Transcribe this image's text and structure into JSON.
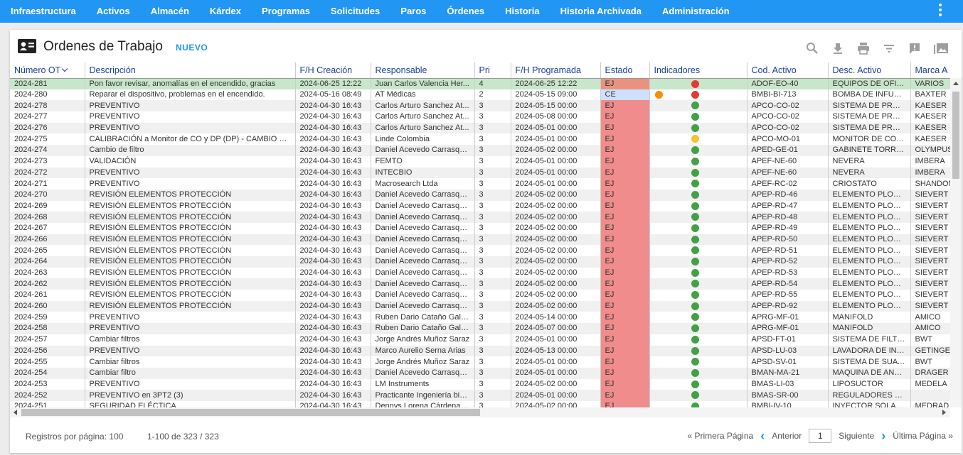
{
  "nav": {
    "items": [
      "Infraestructura",
      "Activos",
      "Almacén",
      "Kárdex",
      "Programas",
      "Solicitudes",
      "Paros",
      "Órdenes",
      "Historia",
      "Historia Archivada",
      "Administración"
    ],
    "more_icon": "more-vert-icon"
  },
  "header": {
    "title": "Ordenes de Trabajo",
    "new_label": "NUEVO",
    "tools": [
      "search-icon",
      "download-icon",
      "print-icon",
      "filter-icon",
      "comment-icon",
      "gallery-icon"
    ]
  },
  "table": {
    "columns": [
      "Número OT",
      "Descripción",
      "F/H Creación",
      "Responsable",
      "Pri",
      "F/H Programada",
      "Estado",
      "Indicadores",
      "Cod. Activo",
      "Desc. Activo",
      "Marca A"
    ],
    "rows": [
      {
        "ot": "2024-281",
        "desc": "Pon favor revisar, anomalías en el encendido, gracias",
        "created": "2024-06-25 12:22",
        "resp": "Juan Carlos Valencia Her...",
        "pri": "4",
        "sched": "2024-06-25 12:22",
        "estado": "EJ",
        "ind": "red",
        "extra": "",
        "cod": "ADOF-EO-40",
        "dact": "EQUIPOS DE OFICI...",
        "marca": "VARIOS"
      },
      {
        "ot": "2024-280",
        "desc": "Reparar el dispositivo, problemas en el encendido.",
        "created": "2024-05-16 08:49",
        "resp": "AT Médicas",
        "pri": "2",
        "sched": "2024-05-15 09:00",
        "estado": "CE",
        "ind": "red",
        "extra": "orange",
        "cod": "BMBI-BI-713",
        "dact": "BOMBA DE INFUSI...",
        "marca": "BAXTER"
      },
      {
        "ot": "2024-278",
        "desc": "PREVENTIVO",
        "created": "2024-04-30 16:43",
        "resp": "Carlos Arturo Sanchez At...",
        "pri": "3",
        "sched": "2024-05-15 00:00",
        "estado": "EJ",
        "ind": "green",
        "extra": "",
        "cod": "APCO-CO-02",
        "dact": "SISTEMA DE PROD...",
        "marca": "KAESER"
      },
      {
        "ot": "2024-277",
        "desc": "PREVENTIVO",
        "created": "2024-04-30 16:43",
        "resp": "Carlos Arturo Sanchez At...",
        "pri": "3",
        "sched": "2024-05-08 00:00",
        "estado": "EJ",
        "ind": "green",
        "extra": "",
        "cod": "APCO-CO-02",
        "dact": "SISTEMA DE PROD...",
        "marca": "KAESER"
      },
      {
        "ot": "2024-276",
        "desc": "PREVENTIVO",
        "created": "2024-04-30 16:43",
        "resp": "Carlos Arturo Sanchez At...",
        "pri": "3",
        "sched": "2024-05-01 00:00",
        "estado": "EJ",
        "ind": "green",
        "extra": "",
        "cod": "APCO-CO-02",
        "dact": "SISTEMA DE PROD...",
        "marca": "KAESER"
      },
      {
        "ot": "2024-275",
        "desc": "CALIBRACIÓN a Monitor de CO y DP (DP) - CAMBIO DE ...",
        "created": "2024-04-30 16:43",
        "resp": "Linde Colombia",
        "pri": "3",
        "sched": "2024-05-01 00:00",
        "estado": "EJ",
        "ind": "yellow",
        "extra": "",
        "cod": "APCO-MO-01",
        "dact": "MONITOR DE CO Y ...",
        "marca": "KAESER"
      },
      {
        "ot": "2024-274",
        "desc": "Cambio de filtro",
        "created": "2024-04-30 16:43",
        "resp": "Daniel Acevedo Carrasqu...",
        "pri": "3",
        "sched": "2024-05-02 00:00",
        "estado": "EJ",
        "ind": "green",
        "extra": "",
        "cod": "APED-GE-01",
        "dact": "GABINETE TORRE ...",
        "marca": "OLYMPUS"
      },
      {
        "ot": "2024-273",
        "desc": "VALIDACIÓN",
        "created": "2024-04-30 16:43",
        "resp": "FEMTO",
        "pri": "3",
        "sched": "2024-05-01 00:00",
        "estado": "EJ",
        "ind": "green",
        "extra": "",
        "cod": "APEF-NE-60",
        "dact": "NEVERA",
        "marca": "IMBERA"
      },
      {
        "ot": "2024-272",
        "desc": "PREVENTIVO",
        "created": "2024-04-30 16:43",
        "resp": "INTECBIO",
        "pri": "3",
        "sched": "2024-05-01 00:00",
        "estado": "EJ",
        "ind": "green",
        "extra": "",
        "cod": "APEF-NE-60",
        "dact": "NEVERA",
        "marca": "IMBERA"
      },
      {
        "ot": "2024-271",
        "desc": "PREVENTIVO",
        "created": "2024-04-30 16:43",
        "resp": "Macrosearch Ltda",
        "pri": "3",
        "sched": "2024-05-01 00:00",
        "estado": "EJ",
        "ind": "green",
        "extra": "",
        "cod": "APEF-RC-02",
        "dact": "CRIOSTATO",
        "marca": "SHANDON"
      },
      {
        "ot": "2024-270",
        "desc": "REVISIÓN ELEMENTOS PROTECCIÓN",
        "created": "2024-04-30 16:43",
        "resp": "Daniel Acevedo Carrasqu...",
        "pri": "3",
        "sched": "2024-05-02 00:00",
        "estado": "EJ",
        "ind": "green",
        "extra": "",
        "cod": "APEP-RD-46",
        "dact": "ELEMENTO PLOMA...",
        "marca": "SIEVERT"
      },
      {
        "ot": "2024-269",
        "desc": "REVISIÓN ELEMENTOS PROTECCIÓN",
        "created": "2024-04-30 16:43",
        "resp": "Daniel Acevedo Carrasqu...",
        "pri": "3",
        "sched": "2024-05-02 00:00",
        "estado": "EJ",
        "ind": "green",
        "extra": "",
        "cod": "APEP-RD-47",
        "dact": "ELEMENTO PLOMA...",
        "marca": "SIEVERT"
      },
      {
        "ot": "2024-268",
        "desc": "REVISIÓN ELEMENTOS PROTECCIÓN",
        "created": "2024-04-30 16:43",
        "resp": "Daniel Acevedo Carrasqu...",
        "pri": "3",
        "sched": "2024-05-02 00:00",
        "estado": "EJ",
        "ind": "green",
        "extra": "",
        "cod": "APEP-RD-48",
        "dact": "ELEMENTO PLOMA...",
        "marca": "SIEVERT"
      },
      {
        "ot": "2024-267",
        "desc": "REVISIÓN ELEMENTOS PROTECCIÓN",
        "created": "2024-04-30 16:43",
        "resp": "Daniel Acevedo Carrasqu...",
        "pri": "3",
        "sched": "2024-05-02 00:00",
        "estado": "EJ",
        "ind": "green",
        "extra": "",
        "cod": "APEP-RD-49",
        "dact": "ELEMENTO PLOMA...",
        "marca": "SIEVERT"
      },
      {
        "ot": "2024-266",
        "desc": "REVISIÓN ELEMENTOS PROTECCIÓN",
        "created": "2024-04-30 16:43",
        "resp": "Daniel Acevedo Carrasqu...",
        "pri": "3",
        "sched": "2024-05-02 00:00",
        "estado": "EJ",
        "ind": "green",
        "extra": "",
        "cod": "APEP-RD-50",
        "dact": "ELEMENTO PLOMA...",
        "marca": "SIEVERT"
      },
      {
        "ot": "2024-265",
        "desc": "REVISIÓN ELEMENTOS PROTECCIÓN",
        "created": "2024-04-30 16:43",
        "resp": "Daniel Acevedo Carrasqu...",
        "pri": "3",
        "sched": "2024-05-02 00:00",
        "estado": "EJ",
        "ind": "green",
        "extra": "",
        "cod": "APEP-RD-51",
        "dact": "ELEMENTO PLOMA...",
        "marca": "SIEVERT"
      },
      {
        "ot": "2024-264",
        "desc": "REVISIÓN ELEMENTOS PROTECCIÓN",
        "created": "2024-04-30 16:43",
        "resp": "Daniel Acevedo Carrasqu...",
        "pri": "3",
        "sched": "2024-05-02 00:00",
        "estado": "EJ",
        "ind": "green",
        "extra": "",
        "cod": "APEP-RD-52",
        "dact": "ELEMENTO PLOMA...",
        "marca": "SIEVERT"
      },
      {
        "ot": "2024-263",
        "desc": "REVISIÓN ELEMENTOS PROTECCIÓN",
        "created": "2024-04-30 16:43",
        "resp": "Daniel Acevedo Carrasqu...",
        "pri": "3",
        "sched": "2024-05-02 00:00",
        "estado": "EJ",
        "ind": "green",
        "extra": "",
        "cod": "APEP-RD-53",
        "dact": "ELEMENTO PLOMA...",
        "marca": "SIEVERT"
      },
      {
        "ot": "2024-262",
        "desc": "REVISIÓN ELEMENTOS PROTECCIÓN",
        "created": "2024-04-30 16:43",
        "resp": "Daniel Acevedo Carrasqu...",
        "pri": "3",
        "sched": "2024-05-02 00:00",
        "estado": "EJ",
        "ind": "green",
        "extra": "",
        "cod": "APEP-RD-54",
        "dact": "ELEMENTO PLOMA...",
        "marca": "SIEVERT"
      },
      {
        "ot": "2024-261",
        "desc": "REVISIÓN ELEMENTOS PROTECCIÓN",
        "created": "2024-04-30 16:43",
        "resp": "Daniel Acevedo Carrasqu...",
        "pri": "3",
        "sched": "2024-05-02 00:00",
        "estado": "EJ",
        "ind": "green",
        "extra": "",
        "cod": "APEP-RD-55",
        "dact": "ELEMENTO PLOMA...",
        "marca": "SIEVERT"
      },
      {
        "ot": "2024-260",
        "desc": "REVISIÓN ELEMENTOS PROTECCIÓN",
        "created": "2024-04-30 16:43",
        "resp": "Daniel Acevedo Carrasqu...",
        "pri": "3",
        "sched": "2024-05-02 00:00",
        "estado": "EJ",
        "ind": "green",
        "extra": "",
        "cod": "APEP-RD-92",
        "dact": "ELEMENTO PLOMA...",
        "marca": "SIEVERT"
      },
      {
        "ot": "2024-259",
        "desc": "PREVENTIVO",
        "created": "2024-04-30 16:43",
        "resp": "Ruben Dario Cataño Galle...",
        "pri": "3",
        "sched": "2024-05-14 00:00",
        "estado": "EJ",
        "ind": "green",
        "extra": "",
        "cod": "APRG-MF-01",
        "dact": "MANIFOLD",
        "marca": "AMICO"
      },
      {
        "ot": "2024-258",
        "desc": "PREVENTIVO",
        "created": "2024-04-30 16:43",
        "resp": "Ruben Dario Cataño Galle...",
        "pri": "3",
        "sched": "2024-05-07 00:00",
        "estado": "EJ",
        "ind": "green",
        "extra": "",
        "cod": "APRG-MF-01",
        "dact": "MANIFOLD",
        "marca": "AMICO"
      },
      {
        "ot": "2024-257",
        "desc": "Cambiar filtros",
        "created": "2024-04-30 16:43",
        "resp": "Jorge Andrés Muñoz Saraz",
        "pri": "3",
        "sched": "2024-05-01 00:00",
        "estado": "EJ",
        "ind": "green",
        "extra": "",
        "cod": "APSD-FT-01",
        "dact": "SISTEMA DE FILTR...",
        "marca": "BWT"
      },
      {
        "ot": "2024-256",
        "desc": "PREVENTIVO",
        "created": "2024-04-30 16:43",
        "resp": "Marco Aurelio Serna Arias",
        "pri": "3",
        "sched": "2024-05-13 00:00",
        "estado": "EJ",
        "ind": "green",
        "extra": "",
        "cod": "APSD-LU-03",
        "dact": "LAVADORA DE INS...",
        "marca": "GETINGE"
      },
      {
        "ot": "2024-255",
        "desc": "Cambiar filtros",
        "created": "2024-04-30 16:43",
        "resp": "Jorge Andrés Muñoz Saraz",
        "pri": "3",
        "sched": "2024-05-01 00:00",
        "estado": "EJ",
        "ind": "green",
        "extra": "",
        "cod": "APSD-SV-01",
        "dact": "SISTEMA DE SUAVI...",
        "marca": "BWT"
      },
      {
        "ot": "2024-254",
        "desc": "Cambiar filtro",
        "created": "2024-04-30 16:43",
        "resp": "Daniel Acevedo Carrasqu...",
        "pri": "3",
        "sched": "2024-05-01 00:00",
        "estado": "EJ",
        "ind": "green",
        "extra": "",
        "cod": "BMAN-MA-21",
        "dact": "MAQUINA DE ANE...",
        "marca": "DRAGER"
      },
      {
        "ot": "2024-253",
        "desc": "PREVENTIVO",
        "created": "2024-04-30 16:43",
        "resp": "LM Instruments",
        "pri": "3",
        "sched": "2024-05-02 00:00",
        "estado": "EJ",
        "ind": "green",
        "extra": "",
        "cod": "BMAS-LI-03",
        "dact": "LIPOSUCTOR",
        "marca": "MEDELA"
      },
      {
        "ot": "2024-252",
        "desc": "PREVENTIVO en 3PT2 (3)",
        "created": "2024-04-30 16:43",
        "resp": "Practicante Ingeniería bio...",
        "pri": "3",
        "sched": "2024-05-01 00:00",
        "estado": "EJ",
        "ind": "green",
        "extra": "",
        "cod": "BMAS-SR-00",
        "dact": "REGULADORES DE ...",
        "marca": ""
      },
      {
        "ot": "2024-251",
        "desc": "SEGURIDAD ELÉCTICA",
        "created": "2024-04-30 16:43",
        "resp": "Dennys Lorena Cárdenas ...",
        "pri": "3",
        "sched": "2024-05-02 00:00",
        "estado": "EJ",
        "ind": "green",
        "extra": "",
        "cod": "BMBI-IV-10",
        "dact": "INYECTOR SOLARI...",
        "marca": "MEDRAD"
      }
    ]
  },
  "footer": {
    "rows_per_page": "Registros por página: 100",
    "range": "1-100 de 323 / 323",
    "first": "« Primera Página",
    "prev": "Anterior",
    "page": "1",
    "next": "Siguiente",
    "last": "Última Página »"
  },
  "colors": {
    "nav": "#2196f3",
    "ej": "#f08c8c",
    "ce": "#cfe0ff",
    "selected": "#c8e6c9",
    "dot_red": "#e53935",
    "dot_green": "#43a047",
    "dot_yellow": "#fbc02d",
    "dot_orange": "#fb8c00"
  }
}
